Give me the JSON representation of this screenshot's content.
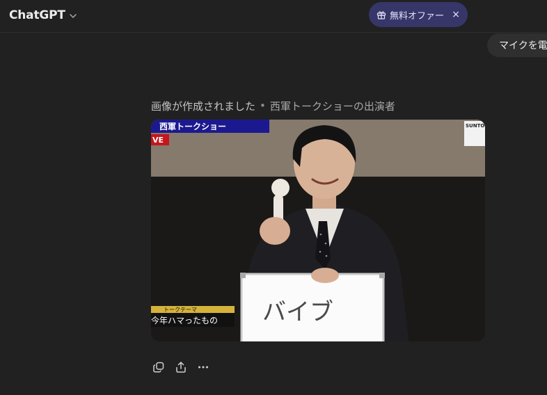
{
  "header": {
    "model_name": "ChatGPT",
    "offer_label": "無料オファー",
    "offer_close": "×"
  },
  "tooltip": {
    "text": "マイクを電"
  },
  "message": {
    "status": "画像が作成されました",
    "separator": "•",
    "title": "西軍トークショーの出演者"
  },
  "image_overlays": {
    "top_banner": "西軍トークショー",
    "live_tag": "VE",
    "corner_title": "SUNTO",
    "theme_label": "トークテーマ",
    "theme_text": "今年ハマったもの",
    "board_text": "バイブ"
  },
  "icons": {
    "model": "chevron-down-icon",
    "offer": "gift-icon",
    "copy": "copy-icon",
    "share": "share-icon",
    "more": "more-icon"
  }
}
